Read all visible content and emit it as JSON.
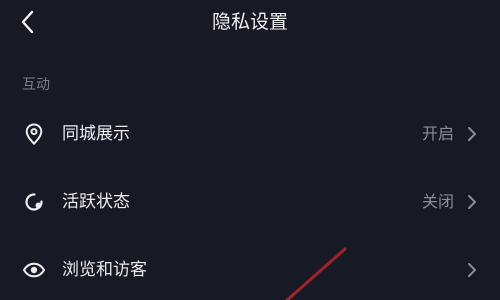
{
  "header": {
    "title": "隐私设置",
    "back_icon": "chevron-left-icon"
  },
  "section": {
    "title": "互动"
  },
  "rows": [
    {
      "label": "同城展示",
      "value": "开启",
      "icon": "location-pin-icon"
    },
    {
      "label": "活跃状态",
      "value": "关闭",
      "icon": "activity-status-icon"
    },
    {
      "label": "浏览和访客",
      "value": "",
      "icon": "eye-icon"
    }
  ],
  "colors": {
    "background": "#171924",
    "text_primary": "#ececef",
    "text_secondary": "#8c8e96",
    "section_header": "#7d7f88",
    "annotation_stroke": "#a0252a"
  }
}
